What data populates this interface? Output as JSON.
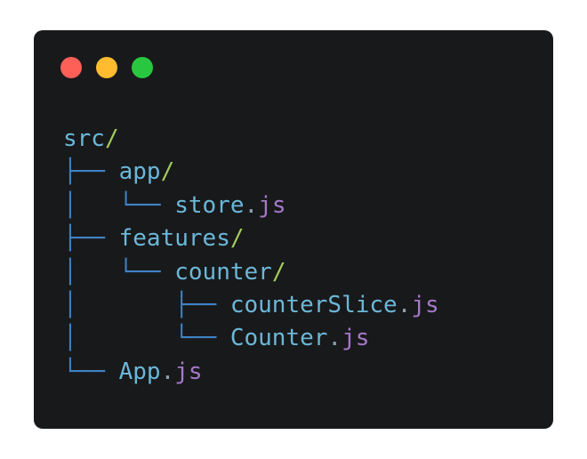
{
  "window_controls": [
    "close",
    "minimize",
    "maximize"
  ],
  "colors": {
    "background": "#18191b",
    "branch": "#3f83c4",
    "name": "#6bb7d8",
    "slash": "#a3cc5a",
    "dot": "#8ea1ad",
    "extension": "#a678c8",
    "close": "#fe5f57",
    "minimize": "#febc2e",
    "maximize": "#29c73f"
  },
  "tree": [
    {
      "branch": "",
      "name": "src",
      "slash": "/",
      "dot": "",
      "ext": ""
    },
    {
      "branch": "├── ",
      "name": "app",
      "slash": "/",
      "dot": "",
      "ext": ""
    },
    {
      "branch": "│   └── ",
      "name": "store",
      "slash": "",
      "dot": ".",
      "ext": "js"
    },
    {
      "branch": "├── ",
      "name": "features",
      "slash": "/",
      "dot": "",
      "ext": ""
    },
    {
      "branch": "│   └── ",
      "name": "counter",
      "slash": "/",
      "dot": "",
      "ext": ""
    },
    {
      "branch": "│       ├── ",
      "name": "counterSlice",
      "slash": "",
      "dot": ".",
      "ext": "js"
    },
    {
      "branch": "│       └── ",
      "name": "Counter",
      "slash": "",
      "dot": ".",
      "ext": "js"
    },
    {
      "branch": "└── ",
      "name": "App",
      "slash": "",
      "dot": ".",
      "ext": "js"
    }
  ]
}
